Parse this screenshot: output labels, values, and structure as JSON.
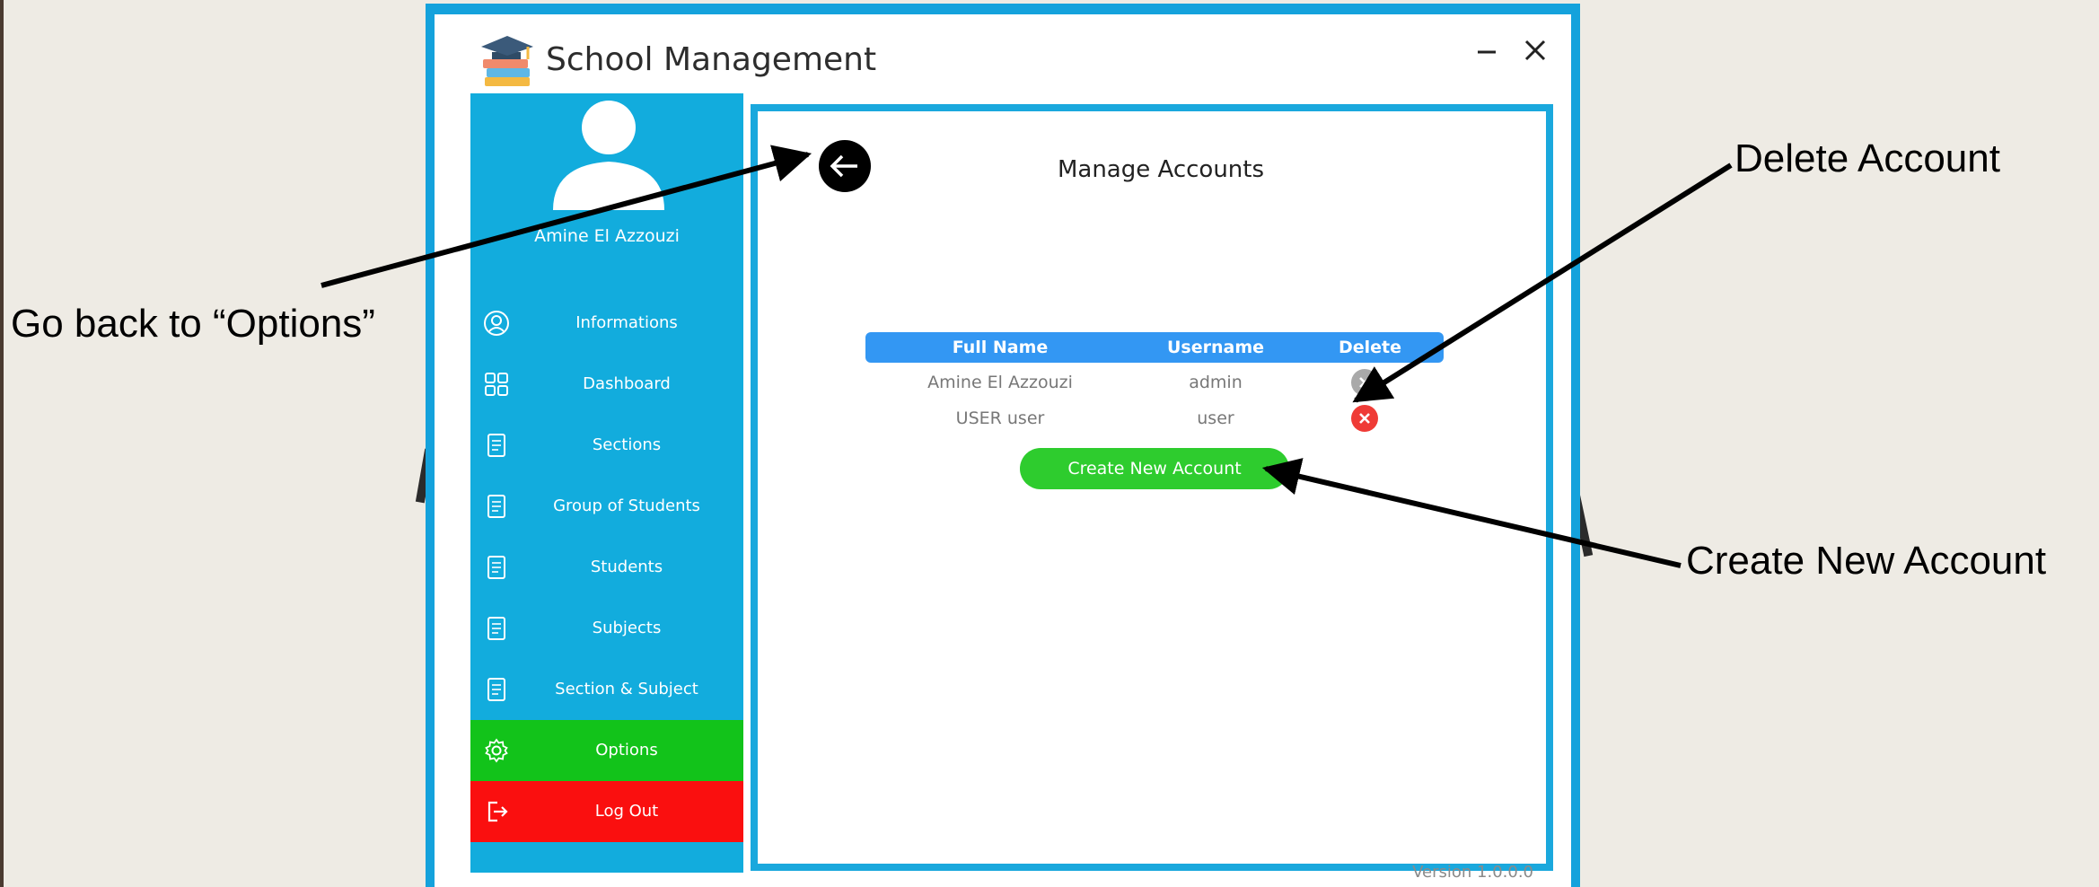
{
  "window": {
    "title": "School Management",
    "minimize_icon": "minimize-icon",
    "close_icon": "close-icon",
    "logo_icon": "books-graduation-cap-icon"
  },
  "sidebar": {
    "user_name": "Amine El Azzouzi",
    "avatar_icon": "user-silhouette-icon",
    "items": [
      {
        "label": "Informations",
        "icon": "user-circle-icon"
      },
      {
        "label": "Dashboard",
        "icon": "grid-icon"
      },
      {
        "label": "Sections",
        "icon": "document-icon"
      },
      {
        "label": "Group of Students",
        "icon": "document-icon"
      },
      {
        "label": "Students",
        "icon": "document-icon"
      },
      {
        "label": "Subjects",
        "icon": "document-icon"
      },
      {
        "label": "Section & Subject",
        "icon": "document-icon"
      },
      {
        "label": "Options",
        "icon": "gear-icon",
        "active": true
      },
      {
        "label": "Log Out",
        "icon": "logout-icon"
      }
    ]
  },
  "main": {
    "title": "Manage Accounts",
    "back_icon": "arrow-left-icon",
    "table": {
      "columns": [
        "Full Name",
        "Username",
        "Delete"
      ],
      "rows": [
        {
          "full_name": "Amine El Azzouzi",
          "username": "admin",
          "delete_state": "disabled"
        },
        {
          "full_name": "USER user",
          "username": "user",
          "delete_state": "enabled"
        }
      ]
    },
    "create_button": "Create New Account",
    "version": "Version 1.0.0.0"
  },
  "callouts": {
    "back": "Go back to “Options”",
    "delete": "Delete Account",
    "create": "Create New Account"
  },
  "colors": {
    "frame_blue": "#14a2dc",
    "sidebar_blue": "#12acdd",
    "options_green": "#12c31a",
    "logout_red": "#fa0f0f",
    "header_blue": "#3397f3",
    "create_green": "#2ecc2e",
    "delete_red": "#ef3b36",
    "delete_gray": "#a9a9a9"
  }
}
